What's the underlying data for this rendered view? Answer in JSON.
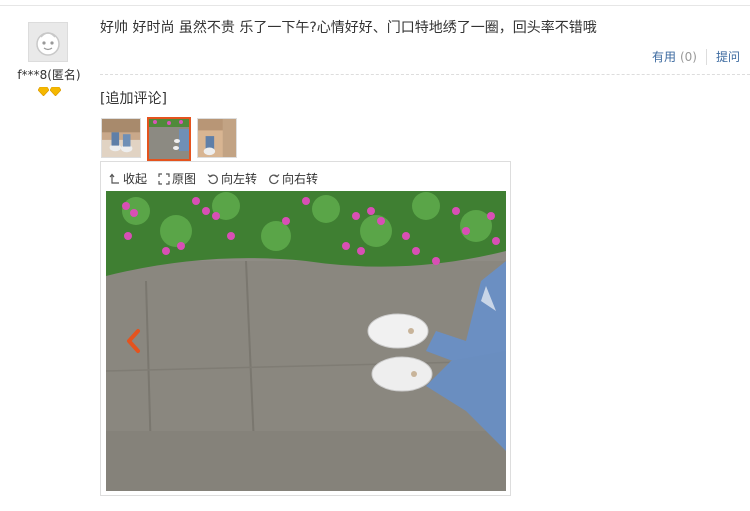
{
  "user": {
    "name": "f***8(匿名)",
    "avatar_icon": "default-avatar-icon",
    "rank_icon": "diamond-rank-icon"
  },
  "review": {
    "text": "好帅 好时尚 虽然不贵 乐了一下午?心情好好、门口特地绣了一圈，回头率不错哦",
    "useful_label": "有用",
    "useful_count": "(0)",
    "ask_label": "提问"
  },
  "appended": {
    "label": "[追加评论]"
  },
  "gallery": {
    "selected_index": 1,
    "thumbnails": [
      {
        "name": "thumbnail-1",
        "icon": "photo-thumbnail"
      },
      {
        "name": "thumbnail-2",
        "icon": "photo-thumbnail"
      },
      {
        "name": "thumbnail-3",
        "icon": "photo-thumbnail"
      }
    ]
  },
  "viewer": {
    "collapse_label": "收起",
    "original_label": "原图",
    "rotate_left_label": "向左转",
    "rotate_right_label": "向右转",
    "prev_icon": "chevron-left-icon"
  },
  "colors": {
    "link": "#3c6aa0",
    "accent": "#e4531e"
  }
}
